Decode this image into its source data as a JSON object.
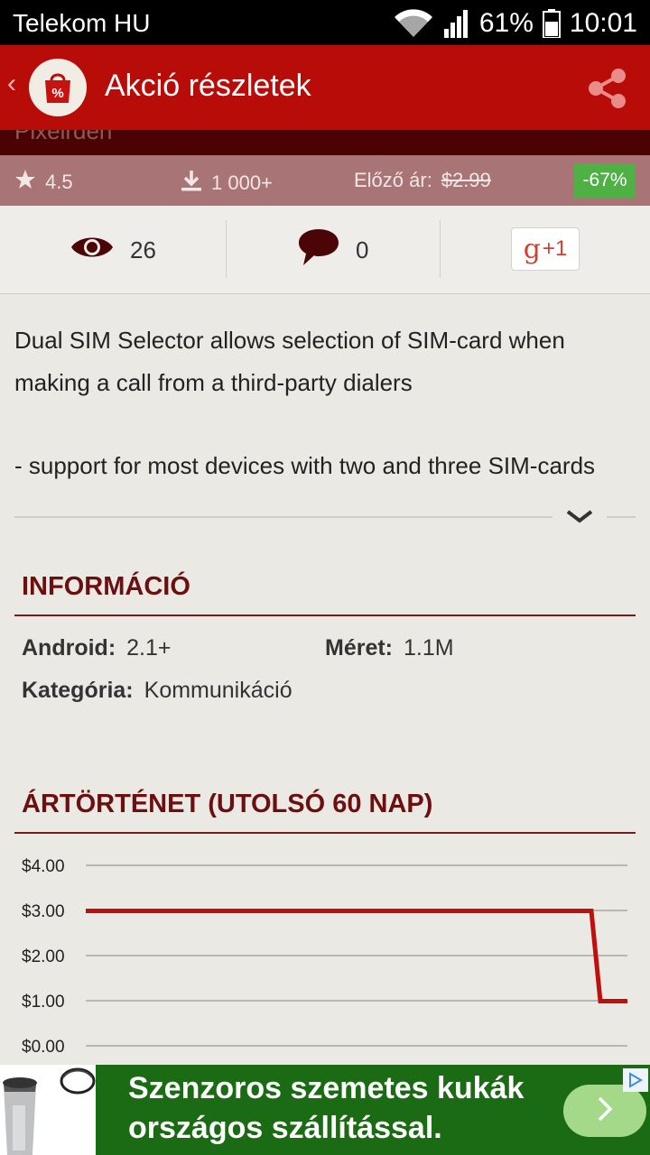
{
  "status_bar": {
    "carrier": "Telekom HU",
    "battery": "61%",
    "time": "10:01",
    "icons": [
      "wifi-icon",
      "signal-icon",
      "battery-icon"
    ]
  },
  "app_bar": {
    "title": "Akció részletek",
    "logo_icon": "shopping-bag-percent-icon",
    "share_icon": "share-icon"
  },
  "developer": "Pixelrden",
  "stats": {
    "rating": "4.5",
    "downloads": "1 000+",
    "previous_price_label": "Előző ár:",
    "previous_price": "$2.99",
    "discount": "-67%"
  },
  "engagement": {
    "views": "26",
    "comments": "0",
    "gplus_label": "+1"
  },
  "description": {
    "paragraph1": "Dual SIM Selector allows selection of SIM-card when making a call from a third-party dialers",
    "paragraph2": "- support for most devices with two and three SIM-cards"
  },
  "info": {
    "title": "INFORMÁCIÓ",
    "android_label": "Android:",
    "android_value": "2.1+",
    "size_label": "Méret:",
    "size_value": "1.1M",
    "category_label": "Kategória:",
    "category_value": "Kommunikáció"
  },
  "price_history": {
    "title": "ÁRTÖRTÉNET (UTOLSÓ 60 NAP)"
  },
  "chart_data": {
    "type": "line",
    "title": "ÁRTÖRTÉNET (UTOLSÓ 60 NAP)",
    "y_ticks": [
      "$4.00",
      "$3.00",
      "$2.00",
      "$1.00",
      "$0.00"
    ],
    "ylim": [
      0,
      4
    ],
    "grid": true,
    "series": [
      {
        "x": [
          0,
          56,
          57,
          60
        ],
        "values": [
          2.99,
          2.99,
          0.99,
          0.99
        ]
      }
    ],
    "line_color": "#c0100d"
  },
  "ad": {
    "line1": "Szenzoros szemetes kukák",
    "line2": "országos szállítással.",
    "cta_icon": "chevron-right-icon",
    "adchoices_icon": "adchoices-icon"
  }
}
